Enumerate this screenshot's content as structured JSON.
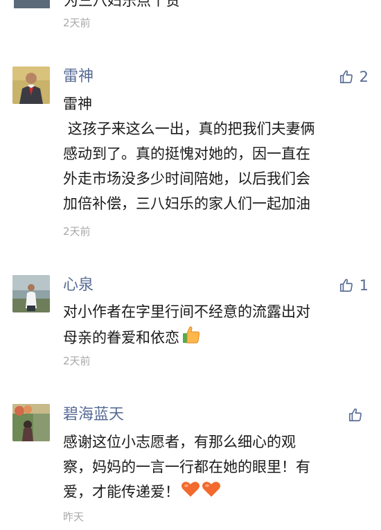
{
  "top_comment": {
    "text_partial": "为三八妇乐点个赞",
    "time": "2天前"
  },
  "comments": [
    {
      "nickname": "雷神",
      "like_count": "2",
      "body_lines": [
        "雷神",
        " 这孩子来这么一出，真的把我们夫妻俩",
        "感动到了。真的挺愧对她的，因一直在",
        "外走市场没多少时间陪她，以后我们会",
        "加倍补偿，三八妇乐的家人们一起加油"
      ],
      "time": "2天前",
      "icons": {
        "like": "thumbs-up-outline-icon"
      }
    },
    {
      "nickname": "心泉",
      "like_count": "1",
      "body_lines": [
        "对小作者在字里行间不经意的流露出对",
        "母亲的眷爱和依恋"
      ],
      "emoji": "thumbs-up-emoji",
      "time": "2天前",
      "icons": {
        "like": "thumbs-up-outline-icon"
      }
    },
    {
      "nickname": "碧海蓝天",
      "like_count": "",
      "body_lines": [
        "感谢这位小志愿者，有那么细心的观",
        "察，妈妈的一言一行都在她的眼里！有",
        "爱，才能传递爱！"
      ],
      "emoji": "orange-heart-emoji x2",
      "time": "昨天",
      "icons": {
        "like": "thumbs-up-outline-icon"
      }
    }
  ],
  "colors": {
    "nickname": "#576b95",
    "time": "#a8a8a8",
    "text": "#1a1a1a"
  }
}
